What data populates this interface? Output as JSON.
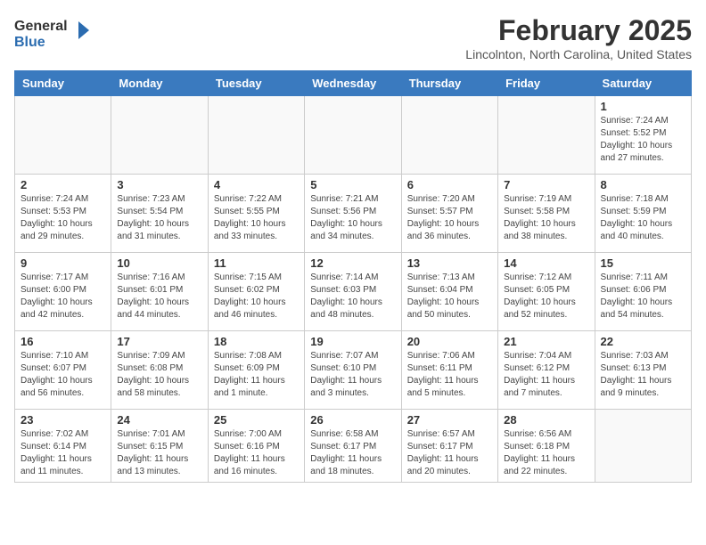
{
  "header": {
    "logo_general": "General",
    "logo_blue": "Blue",
    "month_title": "February 2025",
    "location": "Lincolnton, North Carolina, United States"
  },
  "weekdays": [
    "Sunday",
    "Monday",
    "Tuesday",
    "Wednesday",
    "Thursday",
    "Friday",
    "Saturday"
  ],
  "weeks": [
    [
      {
        "day": "",
        "info": ""
      },
      {
        "day": "",
        "info": ""
      },
      {
        "day": "",
        "info": ""
      },
      {
        "day": "",
        "info": ""
      },
      {
        "day": "",
        "info": ""
      },
      {
        "day": "",
        "info": ""
      },
      {
        "day": "1",
        "info": "Sunrise: 7:24 AM\nSunset: 5:52 PM\nDaylight: 10 hours and 27 minutes."
      }
    ],
    [
      {
        "day": "2",
        "info": "Sunrise: 7:24 AM\nSunset: 5:53 PM\nDaylight: 10 hours and 29 minutes."
      },
      {
        "day": "3",
        "info": "Sunrise: 7:23 AM\nSunset: 5:54 PM\nDaylight: 10 hours and 31 minutes."
      },
      {
        "day": "4",
        "info": "Sunrise: 7:22 AM\nSunset: 5:55 PM\nDaylight: 10 hours and 33 minutes."
      },
      {
        "day": "5",
        "info": "Sunrise: 7:21 AM\nSunset: 5:56 PM\nDaylight: 10 hours and 34 minutes."
      },
      {
        "day": "6",
        "info": "Sunrise: 7:20 AM\nSunset: 5:57 PM\nDaylight: 10 hours and 36 minutes."
      },
      {
        "day": "7",
        "info": "Sunrise: 7:19 AM\nSunset: 5:58 PM\nDaylight: 10 hours and 38 minutes."
      },
      {
        "day": "8",
        "info": "Sunrise: 7:18 AM\nSunset: 5:59 PM\nDaylight: 10 hours and 40 minutes."
      }
    ],
    [
      {
        "day": "9",
        "info": "Sunrise: 7:17 AM\nSunset: 6:00 PM\nDaylight: 10 hours and 42 minutes."
      },
      {
        "day": "10",
        "info": "Sunrise: 7:16 AM\nSunset: 6:01 PM\nDaylight: 10 hours and 44 minutes."
      },
      {
        "day": "11",
        "info": "Sunrise: 7:15 AM\nSunset: 6:02 PM\nDaylight: 10 hours and 46 minutes."
      },
      {
        "day": "12",
        "info": "Sunrise: 7:14 AM\nSunset: 6:03 PM\nDaylight: 10 hours and 48 minutes."
      },
      {
        "day": "13",
        "info": "Sunrise: 7:13 AM\nSunset: 6:04 PM\nDaylight: 10 hours and 50 minutes."
      },
      {
        "day": "14",
        "info": "Sunrise: 7:12 AM\nSunset: 6:05 PM\nDaylight: 10 hours and 52 minutes."
      },
      {
        "day": "15",
        "info": "Sunrise: 7:11 AM\nSunset: 6:06 PM\nDaylight: 10 hours and 54 minutes."
      }
    ],
    [
      {
        "day": "16",
        "info": "Sunrise: 7:10 AM\nSunset: 6:07 PM\nDaylight: 10 hours and 56 minutes."
      },
      {
        "day": "17",
        "info": "Sunrise: 7:09 AM\nSunset: 6:08 PM\nDaylight: 10 hours and 58 minutes."
      },
      {
        "day": "18",
        "info": "Sunrise: 7:08 AM\nSunset: 6:09 PM\nDaylight: 11 hours and 1 minute."
      },
      {
        "day": "19",
        "info": "Sunrise: 7:07 AM\nSunset: 6:10 PM\nDaylight: 11 hours and 3 minutes."
      },
      {
        "day": "20",
        "info": "Sunrise: 7:06 AM\nSunset: 6:11 PM\nDaylight: 11 hours and 5 minutes."
      },
      {
        "day": "21",
        "info": "Sunrise: 7:04 AM\nSunset: 6:12 PM\nDaylight: 11 hours and 7 minutes."
      },
      {
        "day": "22",
        "info": "Sunrise: 7:03 AM\nSunset: 6:13 PM\nDaylight: 11 hours and 9 minutes."
      }
    ],
    [
      {
        "day": "23",
        "info": "Sunrise: 7:02 AM\nSunset: 6:14 PM\nDaylight: 11 hours and 11 minutes."
      },
      {
        "day": "24",
        "info": "Sunrise: 7:01 AM\nSunset: 6:15 PM\nDaylight: 11 hours and 13 minutes."
      },
      {
        "day": "25",
        "info": "Sunrise: 7:00 AM\nSunset: 6:16 PM\nDaylight: 11 hours and 16 minutes."
      },
      {
        "day": "26",
        "info": "Sunrise: 6:58 AM\nSunset: 6:17 PM\nDaylight: 11 hours and 18 minutes."
      },
      {
        "day": "27",
        "info": "Sunrise: 6:57 AM\nSunset: 6:17 PM\nDaylight: 11 hours and 20 minutes."
      },
      {
        "day": "28",
        "info": "Sunrise: 6:56 AM\nSunset: 6:18 PM\nDaylight: 11 hours and 22 minutes."
      },
      {
        "day": "",
        "info": ""
      }
    ]
  ]
}
